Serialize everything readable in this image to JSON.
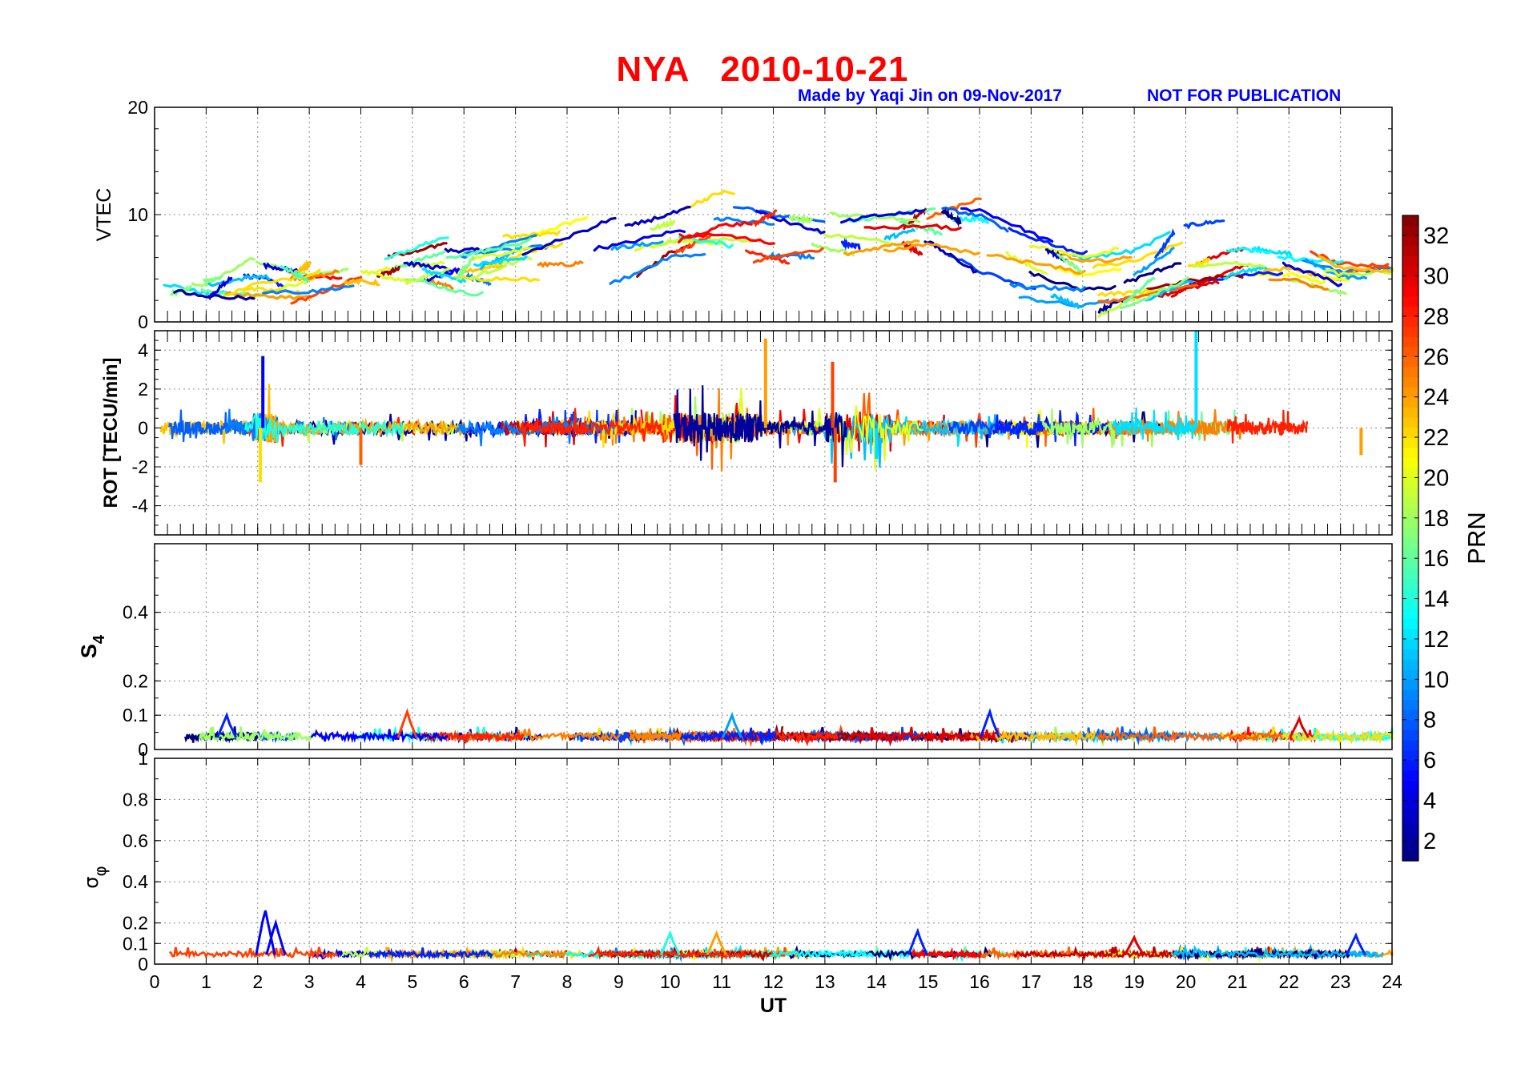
{
  "header": {
    "title": "NYA   2010-10-21",
    "credit": "Made by Yaqi Jin on 09-Nov-2017",
    "notice": "NOT FOR PUBLICATION"
  },
  "colors": {
    "title": "#ff0000",
    "credit": "#0000ff",
    "grid": "#8c8c8c",
    "axis": "#000000"
  },
  "colorbar": {
    "label": "PRN",
    "range": [
      1,
      33
    ],
    "ticks": [
      2,
      4,
      6,
      8,
      10,
      12,
      14,
      16,
      18,
      20,
      22,
      24,
      26,
      28,
      30,
      32
    ],
    "colormap": "jet"
  },
  "chart_data": [
    {
      "type": "line",
      "id": "vtec",
      "ylabel": "VTEC",
      "xlim": [
        0,
        24
      ],
      "ylim": [
        0,
        20
      ],
      "yticks": [
        0,
        10,
        20
      ],
      "grid": true,
      "envelope": {
        "x": [
          0,
          1,
          2,
          3,
          4,
          5,
          6,
          7,
          8,
          9,
          10,
          11,
          12,
          13,
          14,
          15,
          16,
          17,
          18,
          19,
          20,
          21,
          22,
          23,
          24
        ],
        "low": [
          2,
          2,
          2,
          2.5,
          3.5,
          3.5,
          3,
          3.5,
          3,
          4,
          6,
          6,
          6,
          6,
          6,
          6,
          3,
          2,
          1,
          2,
          3,
          4,
          4,
          2.5,
          2.5
        ],
        "high": [
          5,
          4,
          6,
          5,
          6.5,
          7,
          7.5,
          8,
          9,
          10,
          11,
          12.5,
          11,
          10,
          10.5,
          10.5,
          11,
          9,
          7,
          7.5,
          10,
          9.5,
          7.5,
          5.5,
          5.5
        ]
      }
    },
    {
      "type": "line",
      "id": "rot",
      "ylabel": "ROT [TECU/min]",
      "xlim": [
        0,
        24
      ],
      "ylim": [
        -5.5,
        5
      ],
      "yticks": [
        -4,
        -2,
        0,
        2,
        4
      ],
      "grid": true,
      "spikes": [
        {
          "x": 2.1,
          "y": 3.7,
          "prn": 5
        },
        {
          "x": 2.05,
          "y": -2.8,
          "prn": 22
        },
        {
          "x": 4.0,
          "y": -1.9,
          "prn": 26
        },
        {
          "x": 11.85,
          "y": 4.6,
          "prn": 24
        },
        {
          "x": 13.15,
          "y": 3.4,
          "prn": 27
        },
        {
          "x": 13.2,
          "y": -2.8,
          "prn": 27
        },
        {
          "x": 14.0,
          "y": -1.6,
          "prn": 12
        },
        {
          "x": 20.2,
          "y": 5.0,
          "prn": 12
        },
        {
          "x": 23.4,
          "y": -1.4,
          "prn": 24
        }
      ]
    },
    {
      "type": "line",
      "id": "s4",
      "ylabel": "S4",
      "xlim": [
        0,
        24
      ],
      "ylim": [
        0,
        0.6
      ],
      "yticks": [
        0,
        0.1,
        0.2,
        0.4
      ],
      "grid": true,
      "peaks": [
        {
          "x": 1.4,
          "y": 0.1,
          "prn": 6
        },
        {
          "x": 4.9,
          "y": 0.11,
          "prn": 27
        },
        {
          "x": 11.2,
          "y": 0.1,
          "prn": 10
        },
        {
          "x": 16.2,
          "y": 0.11,
          "prn": 6
        },
        {
          "x": 22.2,
          "y": 0.09,
          "prn": 30
        }
      ]
    },
    {
      "type": "line",
      "id": "sigma-phi",
      "ylabel": "σφ",
      "xlim": [
        0,
        24
      ],
      "ylim": [
        0,
        1
      ],
      "yticks": [
        0,
        0.1,
        0.2,
        0.4,
        0.6,
        0.8,
        1
      ],
      "xlabel": "UT",
      "xticks": [
        0,
        1,
        2,
        3,
        4,
        5,
        6,
        7,
        8,
        9,
        10,
        11,
        12,
        13,
        14,
        15,
        16,
        17,
        18,
        19,
        20,
        21,
        22,
        23,
        24
      ],
      "grid": true,
      "peaks": [
        {
          "x": 2.15,
          "y": 0.26,
          "prn": 5
        },
        {
          "x": 2.35,
          "y": 0.2,
          "prn": 5
        },
        {
          "x": 10.0,
          "y": 0.15,
          "prn": 14
        },
        {
          "x": 10.9,
          "y": 0.15,
          "prn": 24
        },
        {
          "x": 14.8,
          "y": 0.16,
          "prn": 6
        },
        {
          "x": 19.0,
          "y": 0.13,
          "prn": 30
        },
        {
          "x": 23.3,
          "y": 0.14,
          "prn": 6
        }
      ]
    }
  ]
}
